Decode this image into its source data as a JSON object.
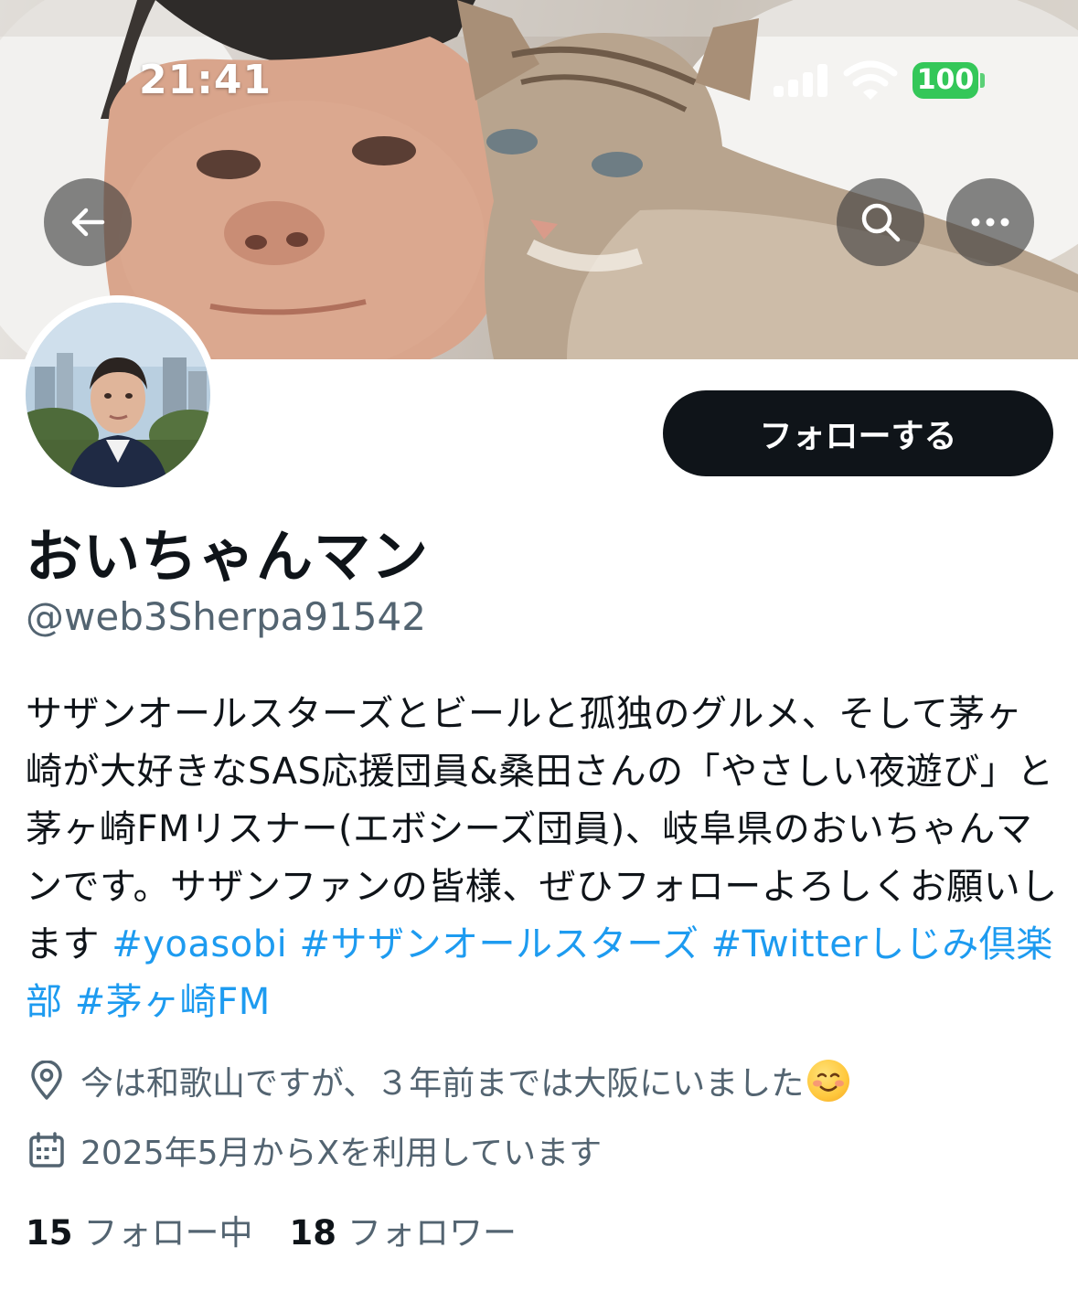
{
  "status_bar": {
    "time": "21:41",
    "battery": "100",
    "icons": [
      "signal-icon",
      "wifi-icon",
      "battery-icon"
    ]
  },
  "banner": {
    "icons": [
      "back-arrow-icon",
      "search-icon",
      "more-icon"
    ]
  },
  "profile": {
    "follow_label": "フォローする",
    "display_name": "おいちゃんマン",
    "handle": "@web3Sherpa91542",
    "bio_text": "サザンオールスターズとビールと孤独のグルメ、そして茅ヶ崎が大好きなSAS応援団員&桑田さんの「やさしい夜遊び」と茅ヶ崎FMリスナー(エボシーズ団員)、岐阜県のおいちゃんマンです。サザンファンの皆様、ぜひフォローよろしくお願いします",
    "hashtags": [
      "#yoasobi",
      "#サザンオールスターズ",
      "#Twitterしじみ倶楽部",
      "#茅ヶ崎FM"
    ],
    "location": "今は和歌山ですが、３年前までは大阪にいました",
    "location_emoji": "smiling-face-emoji",
    "joined": "2025年5月からXを利用しています",
    "following_count": "15",
    "following_label": "フォロー中",
    "followers_count": "18",
    "followers_label": "フォロワー"
  },
  "colors": {
    "text": "#0f1419",
    "secondary": "#536471",
    "link": "#1d9bf0",
    "follow_button": "#0f1419",
    "battery": "#34c759"
  }
}
